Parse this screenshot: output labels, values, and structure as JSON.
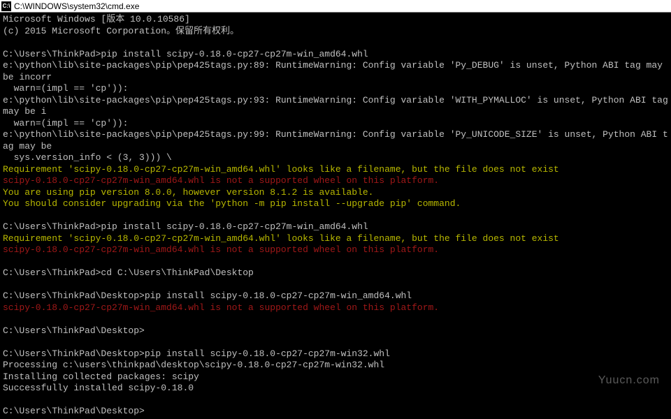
{
  "titlebar": {
    "icon_label": "C:\\",
    "title": "C:\\WINDOWS\\system32\\cmd.exe"
  },
  "lines": [
    {
      "cls": "white",
      "text": "Microsoft Windows [版本 10.0.10586]"
    },
    {
      "cls": "white",
      "text": "(c) 2015 Microsoft Corporation。保留所有权利。"
    },
    {
      "cls": "white",
      "text": ""
    },
    {
      "cls": "white",
      "text": "C:\\Users\\ThinkPad>pip install scipy-0.18.0-cp27-cp27m-win_amd64.whl"
    },
    {
      "cls": "white",
      "text": "e:\\python\\lib\\site-packages\\pip\\pep425tags.py:89: RuntimeWarning: Config variable 'Py_DEBUG' is unset, Python ABI tag may be incorr"
    },
    {
      "cls": "white",
      "text": "  warn=(impl == 'cp')):"
    },
    {
      "cls": "white",
      "text": "e:\\python\\lib\\site-packages\\pip\\pep425tags.py:93: RuntimeWarning: Config variable 'WITH_PYMALLOC' is unset, Python ABI tag may be i"
    },
    {
      "cls": "white",
      "text": "  warn=(impl == 'cp')):"
    },
    {
      "cls": "white",
      "text": "e:\\python\\lib\\site-packages\\pip\\pep425tags.py:99: RuntimeWarning: Config variable 'Py_UNICODE_SIZE' is unset, Python ABI tag may be"
    },
    {
      "cls": "white",
      "text": "  sys.version_info < (3, 3))) \\"
    },
    {
      "cls": "yellow",
      "text": "Requirement 'scipy-0.18.0-cp27-cp27m-win_amd64.whl' looks like a filename, but the file does not exist"
    },
    {
      "cls": "red",
      "text": "scipy-0.18.0-cp27-cp27m-win_amd64.whl is not a supported wheel on this platform."
    },
    {
      "cls": "yellow",
      "text": "You are using pip version 8.0.0, however version 8.1.2 is available."
    },
    {
      "cls": "yellow",
      "text": "You should consider upgrading via the 'python -m pip install --upgrade pip' command."
    },
    {
      "cls": "white",
      "text": ""
    },
    {
      "cls": "white",
      "text": "C:\\Users\\ThinkPad>pip install scipy-0.18.0-cp27-cp27m-win_amd64.whl"
    },
    {
      "cls": "yellow",
      "text": "Requirement 'scipy-0.18.0-cp27-cp27m-win_amd64.whl' looks like a filename, but the file does not exist"
    },
    {
      "cls": "red",
      "text": "scipy-0.18.0-cp27-cp27m-win_amd64.whl is not a supported wheel on this platform."
    },
    {
      "cls": "white",
      "text": ""
    },
    {
      "cls": "white",
      "text": "C:\\Users\\ThinkPad>cd C:\\Users\\ThinkPad\\Desktop"
    },
    {
      "cls": "white",
      "text": ""
    },
    {
      "cls": "white",
      "text": "C:\\Users\\ThinkPad\\Desktop>pip install scipy-0.18.0-cp27-cp27m-win_amd64.whl"
    },
    {
      "cls": "red",
      "text": "scipy-0.18.0-cp27-cp27m-win_amd64.whl is not a supported wheel on this platform."
    },
    {
      "cls": "white",
      "text": ""
    },
    {
      "cls": "white",
      "text": "C:\\Users\\ThinkPad\\Desktop>"
    },
    {
      "cls": "white",
      "text": ""
    },
    {
      "cls": "white",
      "text": "C:\\Users\\ThinkPad\\Desktop>pip install scipy-0.18.0-cp27-cp27m-win32.whl"
    },
    {
      "cls": "white",
      "text": "Processing c:\\users\\thinkpad\\desktop\\scipy-0.18.0-cp27-cp27m-win32.whl"
    },
    {
      "cls": "white",
      "text": "Installing collected packages: scipy"
    },
    {
      "cls": "white",
      "text": "Successfully installed scipy-0.18.0"
    },
    {
      "cls": "white",
      "text": ""
    },
    {
      "cls": "white",
      "text": "C:\\Users\\ThinkPad\\Desktop>"
    }
  ],
  "watermark": "Yuucn.com"
}
